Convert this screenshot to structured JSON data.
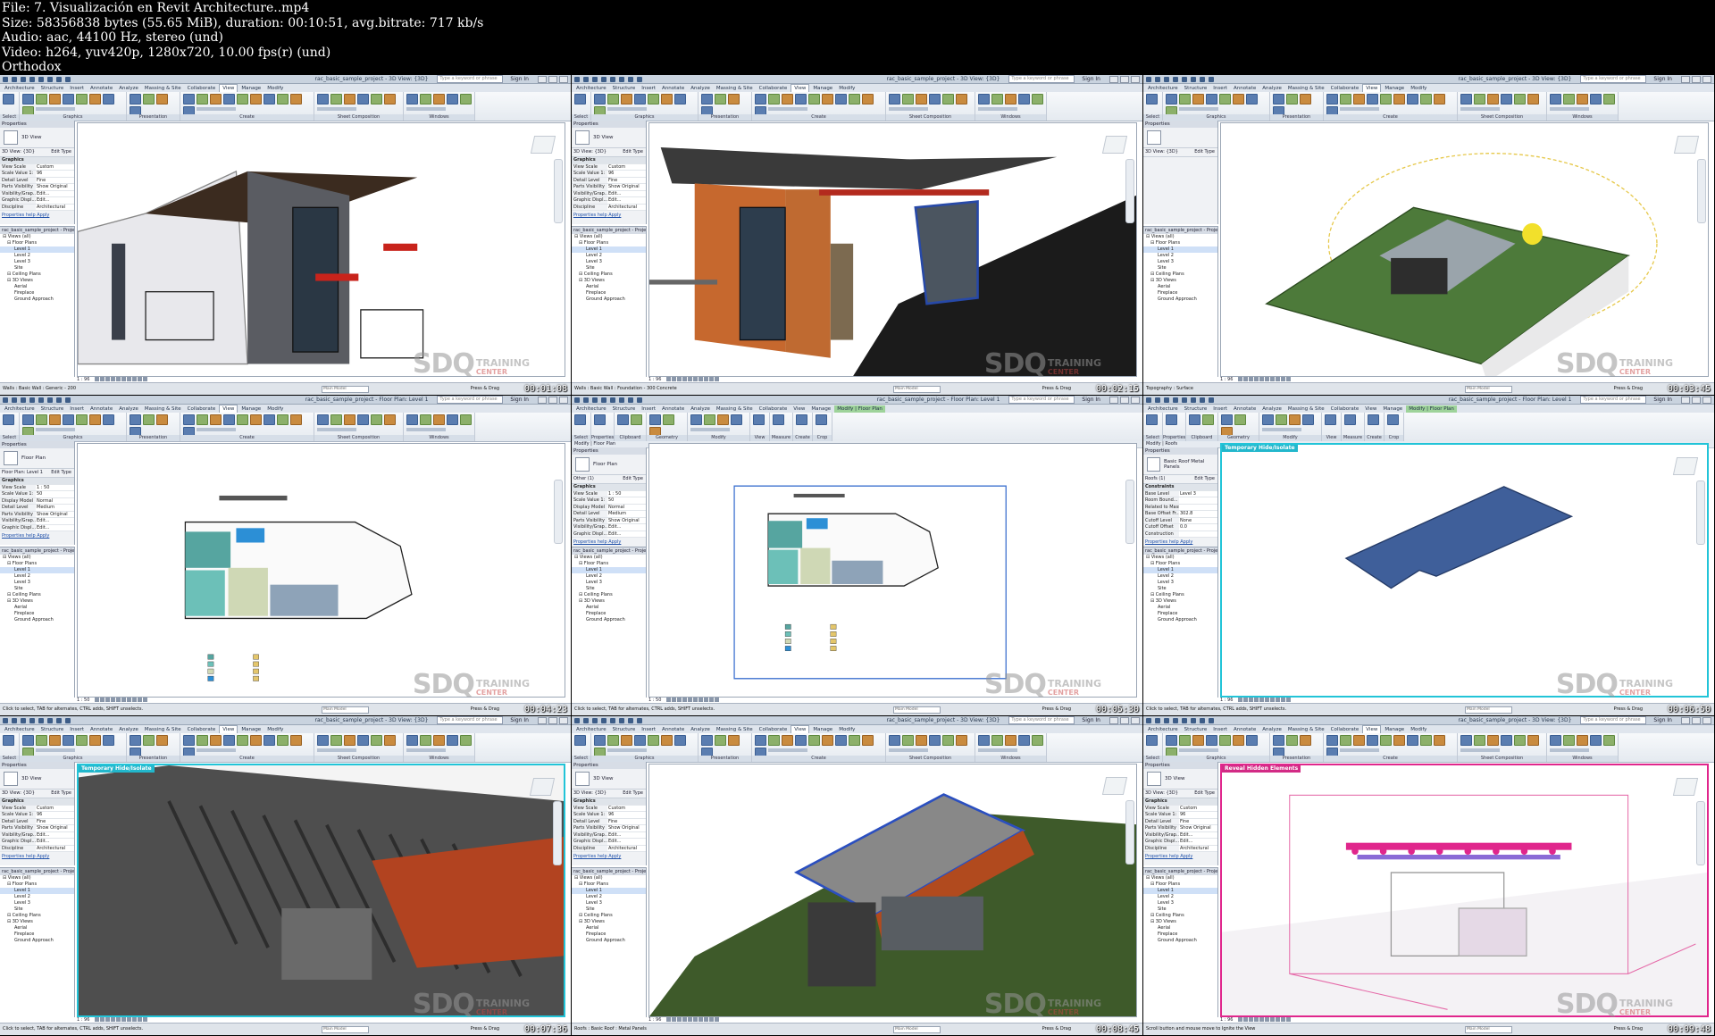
{
  "info": {
    "file": "File: 7. Visualización en Revit Architecture..mp4",
    "size": "Size: 58356838 bytes (55.65 MiB), duration: 00:10:51, avg.bitrate: 717 kb/s",
    "audio": "Audio: aac, 44100 Hz, stereo (und)",
    "video": "Video: h264, yuv420p, 1280x720, 10.00 fps(r) (und)",
    "name": "Orthodox"
  },
  "app": {
    "doc_title_3d": "rac_basic_sample_project - 3D View: {3D}",
    "doc_title_plan": "rac_basic_sample_project - Floor Plan: Level 1",
    "search_placeholder": "Type a keyword or phrase",
    "signin": "Sign In",
    "tabs": [
      "Architecture",
      "Structure",
      "Insert",
      "Annotate",
      "Analyze",
      "Massing & Site",
      "Collaborate",
      "View",
      "Manage",
      "Modify"
    ],
    "modify_tabs": [
      "Architecture",
      "Structure",
      "Insert",
      "Annotate",
      "Analyze",
      "Massing & Site",
      "Collaborate",
      "View",
      "Manage",
      "Modify | Floor Plan"
    ],
    "view_groups": [
      "Select",
      "Graphics",
      "Presentation",
      "Create",
      "Sheet Composition",
      "Windows"
    ],
    "modify_groups": [
      "Select",
      "Properties",
      "Clipboard",
      "Geometry",
      "Modify",
      "View",
      "Measure",
      "Create",
      "Crop"
    ],
    "properties_title": "Properties",
    "edit_type": "Edit Type",
    "properties_help": "Properties help",
    "apply": "Apply",
    "browser_title": "rac_basic_sample_project - Project ...",
    "browser_items": [
      "Views (all)",
      "Floor Plans",
      "Level 1",
      "Level 2",
      "Level 3",
      "Site",
      "Ceiling Plans",
      "3D Views",
      "Aerial",
      "Fireplace",
      "Ground Approach"
    ],
    "press_drag": "Press & Drag",
    "main_model": "Main Model",
    "watermark_main": "SDQ",
    "watermark_top": "TRAINING",
    "watermark_bottom": "CENTER",
    "temp_hide": "Temporary Hide/Isolate",
    "reveal_hidden": "Reveal Hidden Elements"
  },
  "frames": [
    {
      "kind": "3d",
      "ctx": "",
      "timestamp": "00:01:08",
      "type_name": "3D View",
      "selector": "3D View: {3D}",
      "section": "Graphics",
      "props": [
        [
          "View Scale",
          "Custom"
        ],
        [
          "Scale Value 1:",
          "96"
        ],
        [
          "Detail Level",
          "Fine"
        ],
        [
          "Parts Visibility",
          "Show Original"
        ],
        [
          "Visibility/Grap...",
          "Edit..."
        ],
        [
          "Graphic Displ...",
          "Edit..."
        ],
        [
          "Discipline",
          "Architectural"
        ]
      ],
      "scale": "1 : 96",
      "status": "Walls : Basic Wall : Generic - 200",
      "highlight": "",
      "scene": "closeup"
    },
    {
      "kind": "3d",
      "ctx": "",
      "timestamp": "00:02:15",
      "type_name": "3D View",
      "selector": "3D View: {3D}",
      "section": "Graphics",
      "props": [
        [
          "View Scale",
          "Custom"
        ],
        [
          "Scale Value 1:",
          "96"
        ],
        [
          "Detail Level",
          "Fine"
        ],
        [
          "Parts Visibility",
          "Show Original"
        ],
        [
          "Visibility/Grap...",
          "Edit..."
        ],
        [
          "Graphic Displ...",
          "Edit..."
        ],
        [
          "Discipline",
          "Architectural"
        ]
      ],
      "scale": "1 : 96",
      "status": "Walls : Basic Wall : Foundation - 300 Concrete",
      "highlight": "",
      "scene": "house"
    },
    {
      "kind": "3d",
      "ctx": "",
      "timestamp": "00:03:45",
      "type_name": "",
      "selector": "3D View: {3D}",
      "section": "",
      "props": [],
      "scale": "1 : 96",
      "status": "Topography : Surface",
      "highlight": "",
      "scene": "site"
    },
    {
      "kind": "plan",
      "ctx": "",
      "timestamp": "00:04:23",
      "type_name": "Floor Plan",
      "selector": "Floor Plan: Level 1",
      "section": "Graphics",
      "props": [
        [
          "View Scale",
          "1 : 50"
        ],
        [
          "Scale Value 1:",
          "50"
        ],
        [
          "Display Model",
          "Normal"
        ],
        [
          "Detail Level",
          "Medium"
        ],
        [
          "Parts Visibility",
          "Show Original"
        ],
        [
          "Visibility/Grap...",
          "Edit..."
        ],
        [
          "Graphic Displ...",
          "Edit..."
        ]
      ],
      "scale": "1 : 50",
      "status": "Click to select, TAB for alternates, CTRL adds, SHIFT unselects.",
      "highlight": "",
      "scene": "plan"
    },
    {
      "kind": "modify",
      "ctx": "Modify | Floor Plan",
      "timestamp": "00:05:30",
      "type_name": "Floor Plan",
      "selector": "Other (1)",
      "section": "Graphics",
      "props": [
        [
          "View Scale",
          "1 : 50"
        ],
        [
          "Scale Value 1:",
          "50"
        ],
        [
          "Display Model",
          "Normal"
        ],
        [
          "Detail Level",
          "Medium"
        ],
        [
          "Parts Visibility",
          "Show Original"
        ],
        [
          "Visibility/Grap...",
          "Edit..."
        ],
        [
          "Graphic Displ...",
          "Edit..."
        ]
      ],
      "scale": "1 : 50",
      "status": "Click to select, TAB for alternates, CTRL adds, SHIFT unselects.",
      "highlight": "",
      "scene": "plan-crop"
    },
    {
      "kind": "modify",
      "ctx": "Modify | Roofs",
      "timestamp": "00:06:50",
      "type_name": "Basic Roof Metal Panels",
      "selector": "Roofs (1)",
      "section": "Constraints",
      "props": [
        [
          "Base Level",
          "Level 3"
        ],
        [
          "Room Bound...",
          ""
        ],
        [
          "Related to Mass",
          ""
        ],
        [
          "Base Offset Fr...",
          "302.8"
        ],
        [
          "Cutoff Level",
          "None"
        ],
        [
          "Cutoff Offset",
          "0.0"
        ],
        [
          "Construction",
          ""
        ]
      ],
      "scale": "1 : 96",
      "status": "Click to select, TAB for alternates, CTRL adds, SHIFT unselects.",
      "highlight": "temp",
      "scene": "roof"
    },
    {
      "kind": "3d",
      "ctx": "",
      "timestamp": "00:07:36",
      "type_name": "3D View",
      "selector": "3D View: {3D}",
      "section": "Graphics",
      "props": [
        [
          "View Scale",
          "Custom"
        ],
        [
          "Scale Value 1:",
          "96"
        ],
        [
          "Detail Level",
          "Fine"
        ],
        [
          "Parts Visibility",
          "Show Original"
        ],
        [
          "Visibility/Grap...",
          "Edit..."
        ],
        [
          "Graphic Displ...",
          "Edit..."
        ],
        [
          "Discipline",
          "Architectural"
        ]
      ],
      "scale": "1 : 96",
      "status": "Click to select, TAB for alternates, CTRL adds, SHIFT unselects.",
      "highlight": "temp",
      "scene": "closeup-roof"
    },
    {
      "kind": "3d",
      "ctx": "",
      "timestamp": "00:08:45",
      "type_name": "3D View",
      "selector": "3D View: {3D}",
      "section": "Graphics",
      "props": [
        [
          "View Scale",
          "Custom"
        ],
        [
          "Scale Value 1:",
          "96"
        ],
        [
          "Detail Level",
          "Fine"
        ],
        [
          "Parts Visibility",
          "Show Original"
        ],
        [
          "Visibility/Grap...",
          "Edit..."
        ],
        [
          "Graphic Displ...",
          "Edit..."
        ],
        [
          "Discipline",
          "Architectural"
        ]
      ],
      "scale": "1 : 96",
      "status": "Roofs : Basic Roof : Metal Panels",
      "highlight": "",
      "scene": "roof-house"
    },
    {
      "kind": "3d",
      "ctx": "",
      "timestamp": "00:09:48",
      "type_name": "3D View",
      "selector": "3D View: {3D}",
      "section": "Graphics",
      "props": [
        [
          "View Scale",
          "Custom"
        ],
        [
          "Scale Value 1:",
          "96"
        ],
        [
          "Detail Level",
          "Fine"
        ],
        [
          "Parts Visibility",
          "Show Original"
        ],
        [
          "Visibility/Grap...",
          "Edit..."
        ],
        [
          "Graphic Displ...",
          "Edit..."
        ],
        [
          "Discipline",
          "Architectural"
        ]
      ],
      "scale": "1 : 96",
      "status": "Scroll button and mouse move to Ignite the View",
      "highlight": "reveal",
      "scene": "reveal"
    }
  ]
}
